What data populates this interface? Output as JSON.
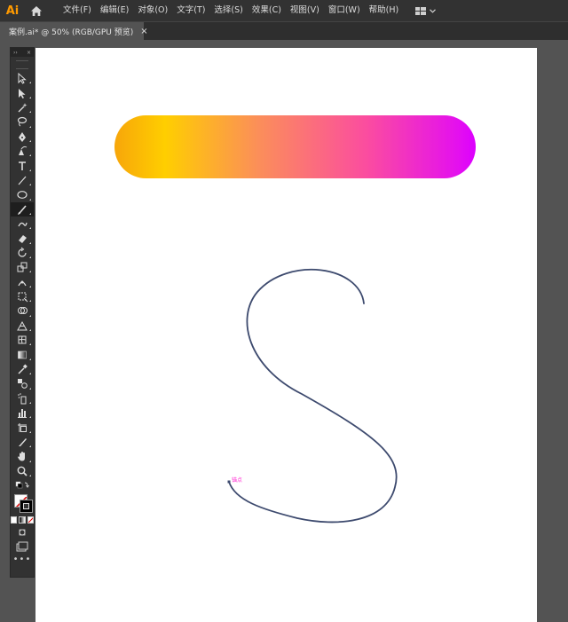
{
  "app": {
    "logo": "Ai",
    "accent": "#ff9a00",
    "home_icon": "home-icon"
  },
  "menu": {
    "items": [
      "文件(F)",
      "编辑(E)",
      "对象(O)",
      "文字(T)",
      "选择(S)",
      "效果(C)",
      "视图(V)",
      "窗口(W)",
      "帮助(H)"
    ],
    "workspace_icon": "workspace-layout-icon"
  },
  "tab": {
    "label": "案例.ai* @ 50% (RGB/GPU 预览)",
    "close": "×"
  },
  "toolbar": {
    "header_left": "››",
    "header_right": "×",
    "more": "•••",
    "tools": [
      "selection-tool",
      "direct-selection-tool",
      "magic-wand-tool",
      "lasso-tool",
      "pen-tool",
      "curvature-tool",
      "type-tool",
      "line-segment-tool",
      "ellipse-tool",
      "paintbrush-tool",
      "shaper-tool",
      "eraser-tool",
      "rotate-tool",
      "scale-tool",
      "puppet-warp-tool",
      "free-transform-tool",
      "shape-builder-tool",
      "perspective-grid-tool",
      "mesh-tool",
      "gradient-tool",
      "eyedropper-tool",
      "blend-tool",
      "symbol-sprayer-tool",
      "column-graph-tool",
      "artboard-tool",
      "slice-tool",
      "hand-tool",
      "zoom-tool"
    ],
    "active_tool": "paintbrush-tool"
  },
  "artboard": {
    "gradient_colors": [
      "#f7a60a",
      "#ffce00",
      "#fb8e5a",
      "#fb4ca0",
      "#e410ee",
      "#dc00ff"
    ],
    "path_stroke": "#3d4a6e",
    "anchor_label": "锚点",
    "anchor_color": "#ff2bd2"
  }
}
